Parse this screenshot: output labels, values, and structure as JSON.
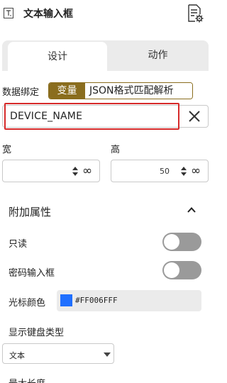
{
  "header": {
    "title": "文本输入框"
  },
  "tabs": [
    {
      "label": "设计",
      "active": true
    },
    {
      "label": "动作",
      "active": false
    }
  ],
  "binding": {
    "label": "数据绑定",
    "options": [
      "变量",
      "JSON格式匹配解析"
    ],
    "selected": "变量",
    "accent_color": "#8a6d1e"
  },
  "device_field": {
    "value": "DEVICE_NAME"
  },
  "size": {
    "width_label": "宽",
    "height_label": "高",
    "width_value": "",
    "height_value": "50",
    "infinity_glyph": "∞"
  },
  "extra": {
    "section_title": "附加属性",
    "readonly_label": "只读",
    "readonly_on": false,
    "password_label": "密码输入框",
    "password_on": false,
    "cursor_color_label": "光标颜色",
    "cursor_color_value": "#FF006FFF",
    "cursor_swatch": "#1f6fff",
    "keyboard_label": "显示键盘类型",
    "keyboard_value": "文本",
    "max_length_label": "最大长度"
  }
}
